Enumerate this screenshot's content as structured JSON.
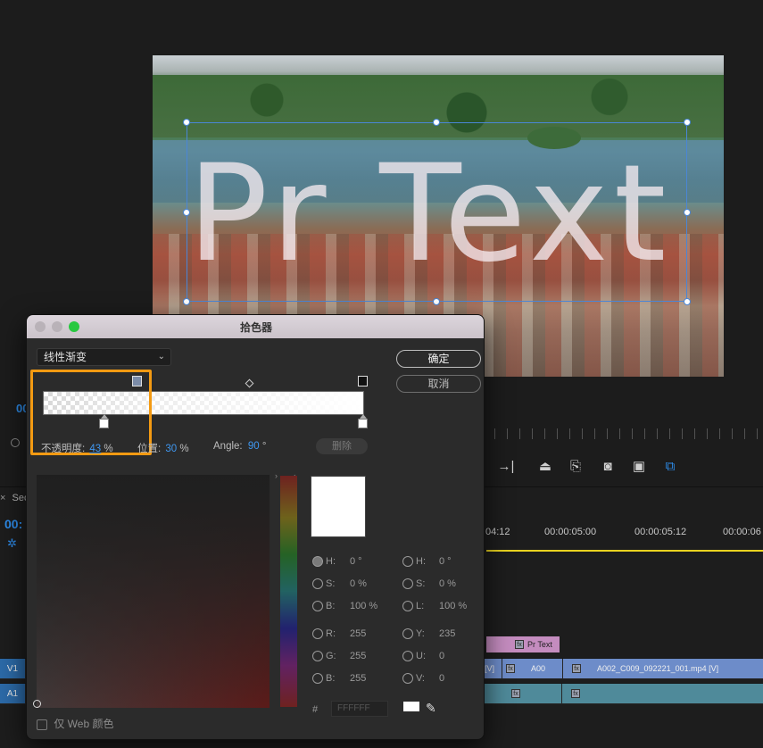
{
  "program_monitor": {
    "overlay_text": "Pr Text",
    "left_timecode_fragment": "00",
    "timeline_left_timecode_fragment": "00:"
  },
  "timeline": {
    "tab_fragment": "Sec",
    "time_labels": [
      "04:12",
      "00:00:05:00",
      "00:00:05:12",
      "00:00:06"
    ],
    "tracks": {
      "v1_label": "V1",
      "a1_label": "A1"
    },
    "clips": {
      "title_clip": "Pr Text",
      "v1_clip_a": "[V]",
      "v1_clip_b": "A00",
      "v1_clip_c": "A002_C009_092221_001.mp4 [V]"
    },
    "fx_badge": "fx"
  },
  "color_picker": {
    "title": "拾色器",
    "mode": "线性渐变",
    "ok_label": "确定",
    "cancel_label": "取消",
    "opacity_label": "不透明度:",
    "opacity_value": "43",
    "opacity_unit": "%",
    "position_label": "位置:",
    "position_value": "30",
    "position_unit": "%",
    "angle_label": "Angle:",
    "angle_value": "90",
    "angle_unit": "°",
    "delete_label": "删除",
    "hsb": {
      "h_label": "H:",
      "h_value": "0 °",
      "s_label": "S:",
      "s_value": "0 %",
      "b_label": "B:",
      "b_value": "100 %"
    },
    "hsl": {
      "h_label": "H:",
      "h_value": "0 °",
      "s_label": "S:",
      "s_value": "0 %",
      "l_label": "L:",
      "l_value": "100 %"
    },
    "rgb": {
      "r_label": "R:",
      "r_value": "255",
      "g_label": "G:",
      "g_value": "255",
      "b_label": "B:",
      "b_value": "255"
    },
    "yuv": {
      "y_label": "Y:",
      "y_value": "235",
      "u_label": "U:",
      "u_value": "0",
      "v_label": "V:",
      "v_value": "0"
    },
    "hex_prefix": "#",
    "hex_value": "FFFFFF",
    "web_only_label": "仅 Web 颜色",
    "colors": {
      "current": "#ffffff",
      "highlight": "#f39a12",
      "accent_blue": "#3f97f0"
    }
  }
}
